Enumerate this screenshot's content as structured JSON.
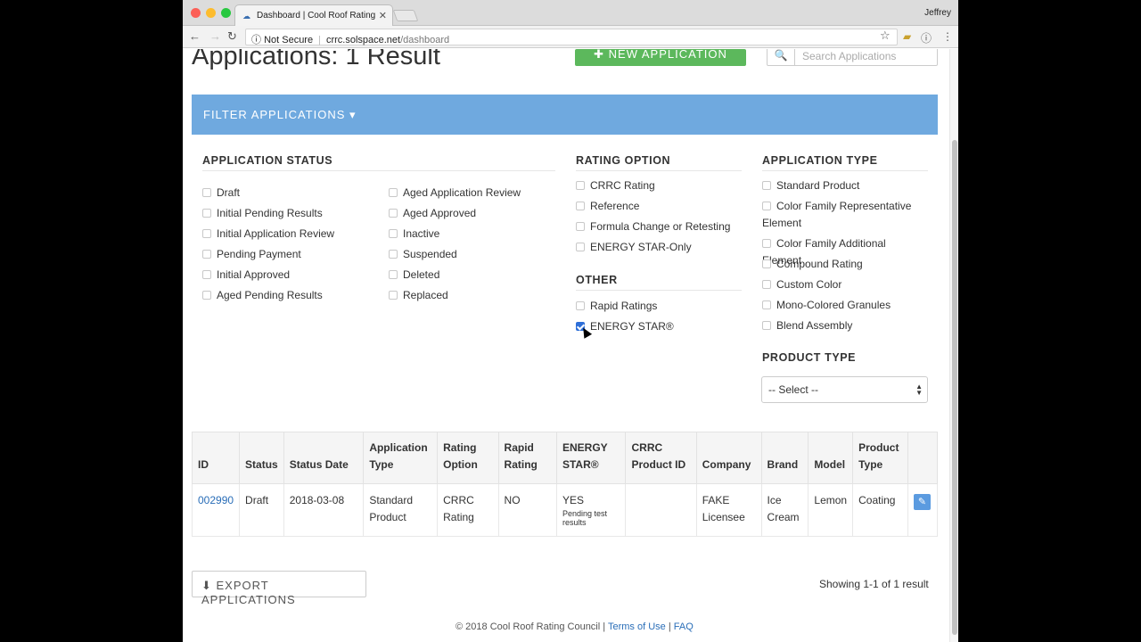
{
  "browser": {
    "tab_title": "Dashboard | Cool Roof Rating",
    "user": "Jeffrey",
    "security": "Not Secure",
    "url_host": "crrc.solspace.net",
    "url_path": "/dashboard"
  },
  "page": {
    "title": "Applications: 1 Result",
    "new_application_label": "NEW APPLICATION",
    "search_placeholder": "Search Applications",
    "filter_toggle": "FILTER APPLICATIONS"
  },
  "filters": {
    "application_status": {
      "heading": "APPLICATION STATUS",
      "col1": [
        "Draft",
        "Initial Pending Results",
        "Initial Application Review",
        "Pending Payment",
        "Initial Approved",
        "Aged Pending Results"
      ],
      "col2": [
        "Aged Application Review",
        "Aged Approved",
        "Inactive",
        "Suspended",
        "Deleted",
        "Replaced"
      ]
    },
    "rating_option": {
      "heading": "RATING OPTION",
      "items": [
        "CRRC Rating",
        "Reference",
        "Formula Change or Retesting",
        "ENERGY STAR-Only"
      ]
    },
    "other": {
      "heading": "OTHER",
      "items": [
        "Rapid Ratings",
        "ENERGY STAR®"
      ],
      "checked": [
        "ENERGY STAR®"
      ]
    },
    "application_type": {
      "heading": "APPLICATION TYPE",
      "items": [
        "Standard Product",
        "Color Family Representative Element",
        "Color Family Additional Element",
        "Compound Rating",
        "Custom Color",
        "Mono-Colored Granules",
        "Blend Assembly"
      ]
    },
    "product_type": {
      "heading": "PRODUCT TYPE",
      "selected": "-- Select --"
    }
  },
  "table": {
    "headers": [
      "ID",
      "Status",
      "Status Date",
      "Application Type",
      "Rating Option",
      "Rapid Rating",
      "ENERGY STAR®",
      "CRRC Product ID",
      "Company",
      "Brand",
      "Model",
      "Product Type"
    ],
    "rows": [
      {
        "id": "002990",
        "status": "Draft",
        "status_date": "2018-03-08",
        "application_type": "Standard Product",
        "rating_option": "CRRC Rating",
        "rapid_rating": "NO",
        "energy_star": "YES",
        "energy_star_note": "Pending test results",
        "crrc_product_id": "",
        "company": "FAKE Licensee",
        "brand": "Ice Cream",
        "model": "Lemon",
        "product_type": "Coating"
      }
    ]
  },
  "footer": {
    "export_label": "EXPORT APPLICATIONS",
    "showing": "Showing 1-1 of 1 result",
    "copyright": "© 2018 Cool Roof Rating Council |",
    "terms": "Terms of Use",
    "sep": "|",
    "faq": "FAQ"
  },
  "colors": {
    "accent": "#6fa9df",
    "success": "#5cb85c",
    "link": "#2a6eb8"
  }
}
